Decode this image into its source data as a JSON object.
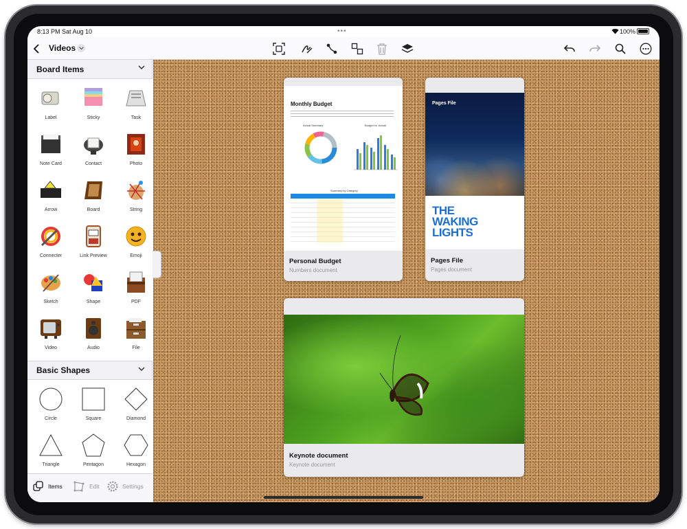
{
  "status": {
    "time": "8:13 PM",
    "date": "Sat Aug 10",
    "battery": "100%"
  },
  "toolbar": {
    "back_icon": "chevron-left-icon",
    "title": "Videos",
    "icons": [
      "select-icon",
      "pen-icon",
      "connect-icon",
      "arrange-icon",
      "trash-icon",
      "layers-icon",
      "undo-icon",
      "redo-icon",
      "search-icon",
      "more-icon"
    ]
  },
  "sidebar": {
    "board_items_title": "Board Items",
    "board_items": [
      {
        "label": "Label",
        "icon": "label-icon"
      },
      {
        "label": "Sticky",
        "icon": "sticky-icon"
      },
      {
        "label": "Task",
        "icon": "task-icon"
      },
      {
        "label": "Note Card",
        "icon": "note-card-icon"
      },
      {
        "label": "Contact",
        "icon": "contact-icon"
      },
      {
        "label": "Photo",
        "icon": "photo-icon"
      },
      {
        "label": "Arrow",
        "icon": "arrow-icon"
      },
      {
        "label": "Board",
        "icon": "board-icon"
      },
      {
        "label": "String",
        "icon": "string-icon"
      },
      {
        "label": "Connecter",
        "icon": "connecter-icon"
      },
      {
        "label": "Link Preview",
        "icon": "link-preview-icon"
      },
      {
        "label": "Emoji",
        "icon": "emoji-icon"
      },
      {
        "label": "Sketch",
        "icon": "sketch-icon"
      },
      {
        "label": "Shape",
        "icon": "shape-icon"
      },
      {
        "label": "PDF",
        "icon": "pdf-icon"
      },
      {
        "label": "Video",
        "icon": "video-icon"
      },
      {
        "label": "Audio",
        "icon": "audio-icon"
      },
      {
        "label": "File",
        "icon": "file-icon"
      }
    ],
    "basic_shapes_title": "Basic Shapes",
    "basic_shapes": [
      {
        "label": "Circle"
      },
      {
        "label": "Square"
      },
      {
        "label": "Diamond"
      },
      {
        "label": "Triangle"
      },
      {
        "label": "Pentagon"
      },
      {
        "label": "Hexagon"
      }
    ],
    "tabs": [
      {
        "label": "Items"
      },
      {
        "label": "Edit"
      },
      {
        "label": "Settings"
      }
    ]
  },
  "cards": {
    "budget": {
      "title": "Personal Budget",
      "subtitle": "Numbers document",
      "doc_heading": "Monthly Budget",
      "chart1": "Actual Summary",
      "chart2": "Budget vs. Actual",
      "table_title": "Summary by Category"
    },
    "pages": {
      "title": "Pages File",
      "subtitle": "Pages document",
      "cover_label": "Pages File",
      "cover_text": "THE WAKING LIGHTS"
    },
    "keynote": {
      "title": "Keynote document",
      "subtitle": "Keynote document"
    }
  },
  "colors": {
    "board": "#c79660",
    "accent": "#2a7de1",
    "cover_blue": "#1f6fd1"
  }
}
